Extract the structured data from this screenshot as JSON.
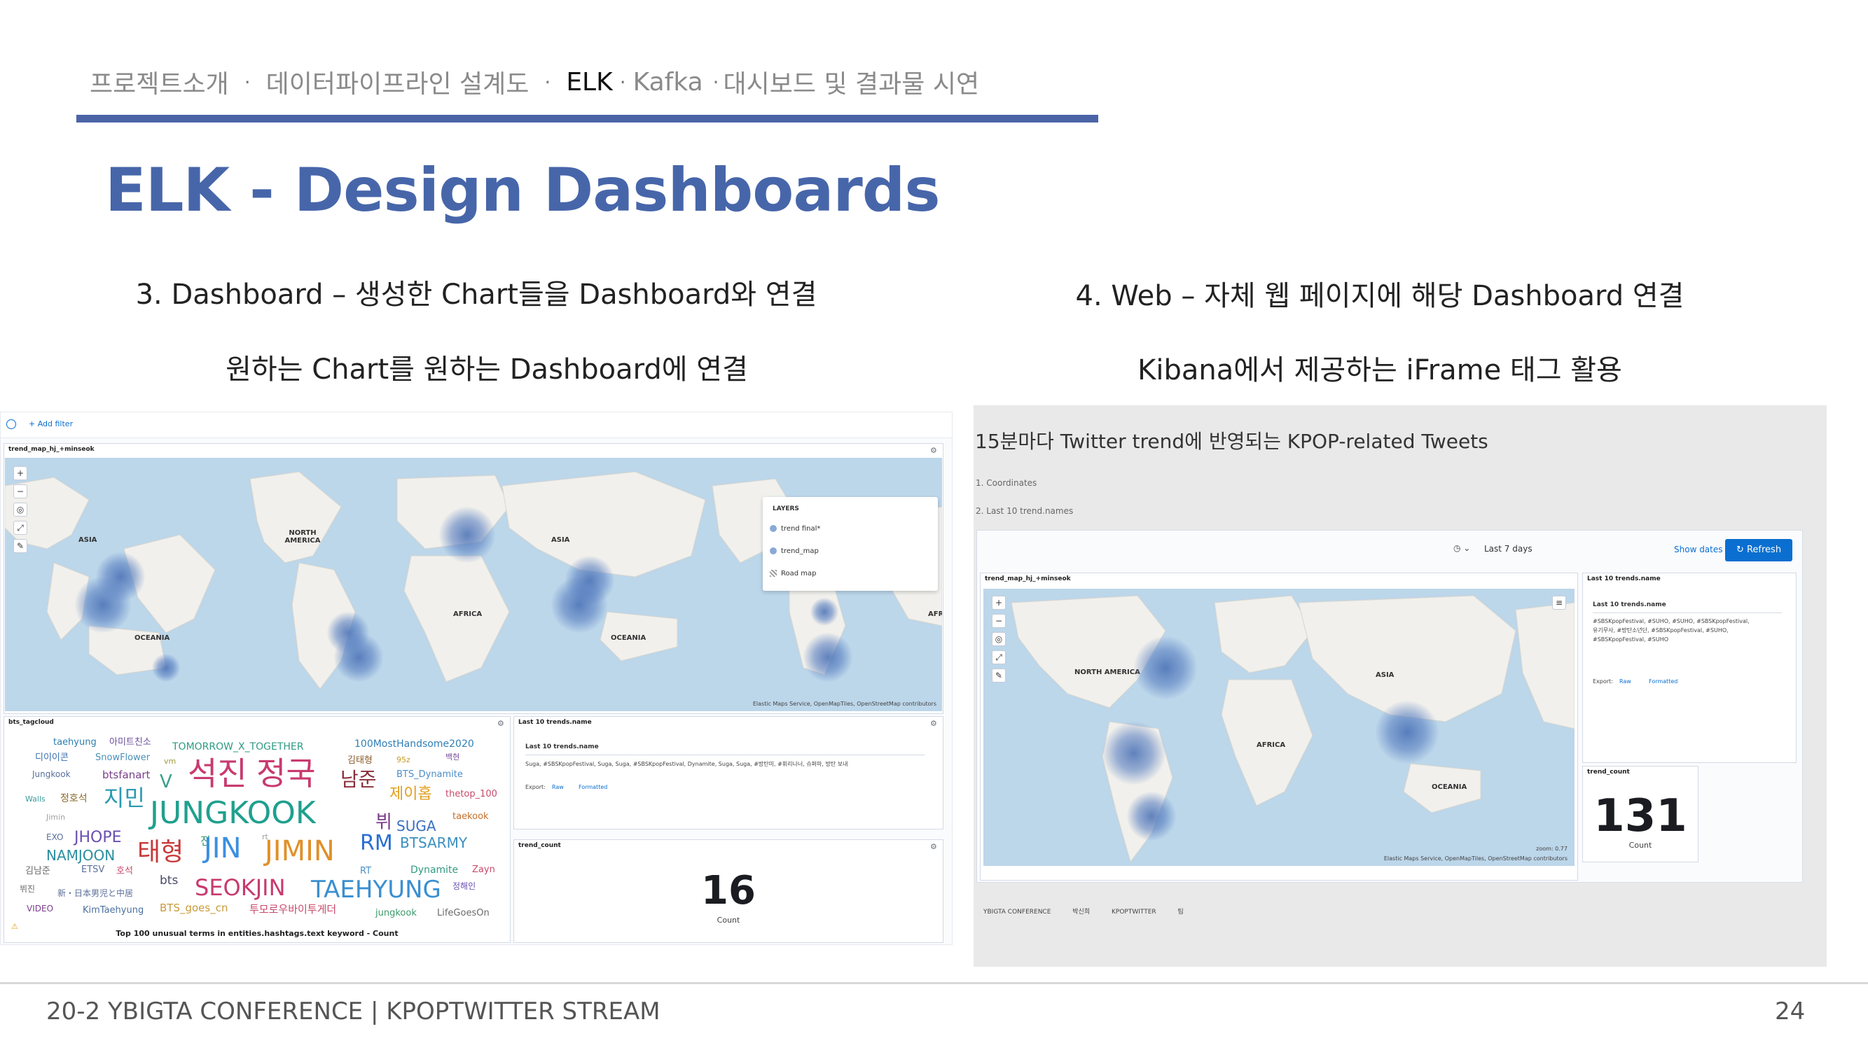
{
  "nav": {
    "items": [
      {
        "label": "프로젝트소개",
        "active": false
      },
      {
        "label": "데이터파이프라인 설계도",
        "active": false
      },
      {
        "label": "ELK",
        "active": true
      },
      {
        "label": "Kafka",
        "active": false
      },
      {
        "label": "대시보드 및 결과물 시연",
        "active": false
      }
    ],
    "separator": "·"
  },
  "title": "ELK - Design Dashboards",
  "left": {
    "caption1": "3. Dashboard – 생성한 Chart들을 Dashboard와 연결",
    "caption2": "원하는 Chart를 원하는 Dashboard에 연결",
    "screenshot": {
      "add_filter": "+ Add filter",
      "map_panel": {
        "title": "trend_map_hj_+minseok",
        "labels": [
          "ASIA",
          "NORTH AMERICA",
          "AFRICA",
          "ASIA",
          "OCEANIA",
          "OCEANIA",
          "AFR"
        ],
        "attribution": "Elastic Maps Service, OpenMapTiles, OpenStreetMap contributors",
        "layers_title": "LAYERS",
        "layers": [
          "trend final*",
          "trend_map",
          "Road map"
        ]
      },
      "tagcloud_panel": {
        "title": "bts_tagcloud",
        "footer": "Top 100 unusual terms in entities.hashtags.text keyword - Count",
        "tags": [
          {
            "t": "taehyung",
            "c": "#2a7fb0"
          },
          {
            "t": "아미트친소",
            "c": "#6b4f9a"
          },
          {
            "t": "TOMORROW_X_TOGETHER",
            "c": "#2f9a82"
          },
          {
            "t": "100MostHandsome2020",
            "c": "#2f7fb6"
          },
          {
            "t": "디이이콘",
            "c": "#3a6fb0"
          },
          {
            "t": "SnowFlower",
            "c": "#4a90b8"
          },
          {
            "t": "vm",
            "c": "#a09a3a"
          },
          {
            "t": "김태형",
            "c": "#8a5a2a"
          },
          {
            "t": "95z",
            "c": "#c99a2a"
          },
          {
            "t": "백현",
            "c": "#7a4f9a"
          },
          {
            "t": "Jungkook",
            "c": "#5a6f9a"
          },
          {
            "t": "btsfanart",
            "c": "#7a3f8a"
          },
          {
            "t": "V",
            "c": "#3aa08a"
          },
          {
            "t": "석진",
            "c": "#c83a6f"
          },
          {
            "t": "정국",
            "c": "#c83a6f"
          },
          {
            "t": "남준",
            "c": "#8a2f3a"
          },
          {
            "t": "BTS_Dynamite",
            "c": "#4a8fc8"
          },
          {
            "t": "Walls",
            "c": "#3a9a9a"
          },
          {
            "t": "정호석",
            "c": "#8a6a2a"
          },
          {
            "t": "지민",
            "c": "#2a9ab0"
          },
          {
            "t": "JUNGKOOK",
            "c": "#1fa08e"
          },
          {
            "t": "제이홉",
            "c": "#e0a020"
          },
          {
            "t": "thetop_100",
            "c": "#c84a6a"
          },
          {
            "t": "Jimin",
            "c": "#a0a0a0"
          },
          {
            "t": "뷔",
            "c": "#7a3a8a"
          },
          {
            "t": "SUGA",
            "c": "#3a6fc0"
          },
          {
            "t": "taekook",
            "c": "#c8702a"
          },
          {
            "t": "EXO",
            "c": "#5a6f9a"
          },
          {
            "t": "JHOPE",
            "c": "#6a4fb0"
          },
          {
            "t": "NAMJOON",
            "c": "#2a8fa0"
          },
          {
            "t": "태형",
            "c": "#c83a3a"
          },
          {
            "t": "진",
            "c": "#3a9a6a"
          },
          {
            "t": "JIN",
            "c": "#3a8fe0"
          },
          {
            "t": "rt",
            "c": "#a0a0a0"
          },
          {
            "t": "JIMIN",
            "c": "#e0902a"
          },
          {
            "t": "RM",
            "c": "#2a6fd0"
          },
          {
            "t": "BTSARMY",
            "c": "#3a8fc0"
          },
          {
            "t": "김남준",
            "c": "#6a6a6a"
          },
          {
            "t": "ETSV",
            "c": "#5a6f9a"
          },
          {
            "t": "호석",
            "c": "#c84a6a"
          },
          {
            "t": "RT",
            "c": "#4a8fc8"
          },
          {
            "t": "Dynamite",
            "c": "#2f9a82"
          },
          {
            "t": "Zayn",
            "c": "#c84a6a"
          },
          {
            "t": "뷔진",
            "c": "#6a6a6a"
          },
          {
            "t": "新・日本男児と中居",
            "c": "#5a6f9a"
          },
          {
            "t": "bts",
            "c": "#4a4a6a"
          },
          {
            "t": "SEOKJIN",
            "c": "#c83a6f"
          },
          {
            "t": "TAEHYUNG",
            "c": "#3a8fd0"
          },
          {
            "t": "정해인",
            "c": "#6a4fb0"
          },
          {
            "t": "VIDEO",
            "c": "#7a3a8a"
          },
          {
            "t": "KimTaehyung",
            "c": "#4a6fa0"
          },
          {
            "t": "BTS_goes_cn",
            "c": "#c89a3a"
          },
          {
            "t": "투모로우바이투게더",
            "c": "#c84a6a"
          },
          {
            "t": "jungkook",
            "c": "#3a9a6a"
          },
          {
            "t": "LifeGoesOn",
            "c": "#6a6a6a"
          }
        ]
      },
      "trends_panel": {
        "title": "Last 10 trends.name",
        "col": "Last 10 trends.name",
        "value": "Suga, #SBSKpopFestival, Suga, Suga, #SBSKpopFestival, Dynamite, Suga, Suga, #방탄미, #휘리나너, 슈퍼마, 방탄 보내",
        "export": "Export:",
        "raw": "Raw",
        "formatted": "Formatted"
      },
      "count_panel": {
        "title": "trend_count",
        "value": "16",
        "label": "Count"
      }
    }
  },
  "right": {
    "caption1": "4. Web – 자체 웹 페이지에 해당 Dashboard 연결",
    "caption2": "Kibana에서 제공하는 iFrame 태그 활용",
    "screenshot": {
      "title": "15분마다 Twitter trend에 반영되는 KPOP-related Tweets",
      "sub1": "1. Coordinates",
      "sub2": "2. Last 10 trend.names",
      "date": "Last 7 days",
      "show_dates": "Show dates",
      "refresh": "Refresh",
      "map_panel": {
        "title": "trend_map_hj_+minseok",
        "labels": [
          "NORTH AMERICA",
          "ASIA",
          "AFRICA",
          "OCEANIA"
        ],
        "attribution": "Elastic Maps Service, OpenMapTiles, OpenStreetMap contributors",
        "zoom": "zoom: 0.77"
      },
      "trends_panel": {
        "title": "Last 10 trends.name",
        "col": "Last 10 trends.name",
        "value": "#SBSKpopFestival, #SUHO, #SUHO, #SBSKpopFestival, 유기무사, #방탄소년단, #SBSKpopFestival, #SUHO, #SBSKpopFestival, #SUHO",
        "export": "Export:",
        "raw": "Raw",
        "formatted": "Formatted"
      },
      "count_panel": {
        "title": "trend_count",
        "value": "131",
        "label": "Count"
      },
      "footer_links": [
        "YBIGTA CONFERENCE",
        "박신희",
        "KPOPTWITTER",
        "팀"
      ]
    }
  },
  "footer": {
    "left": "20-2 YBIGTA CONFERENCE | KPOPTWITTER STREAM",
    "page": "24"
  },
  "colors": {
    "accent": "#4766aa",
    "nav_bar": "#4a64a6",
    "map_water": "#bcd6ea",
    "map_land": "#f1f0ec",
    "kibana_blue": "#0a6fd0"
  }
}
